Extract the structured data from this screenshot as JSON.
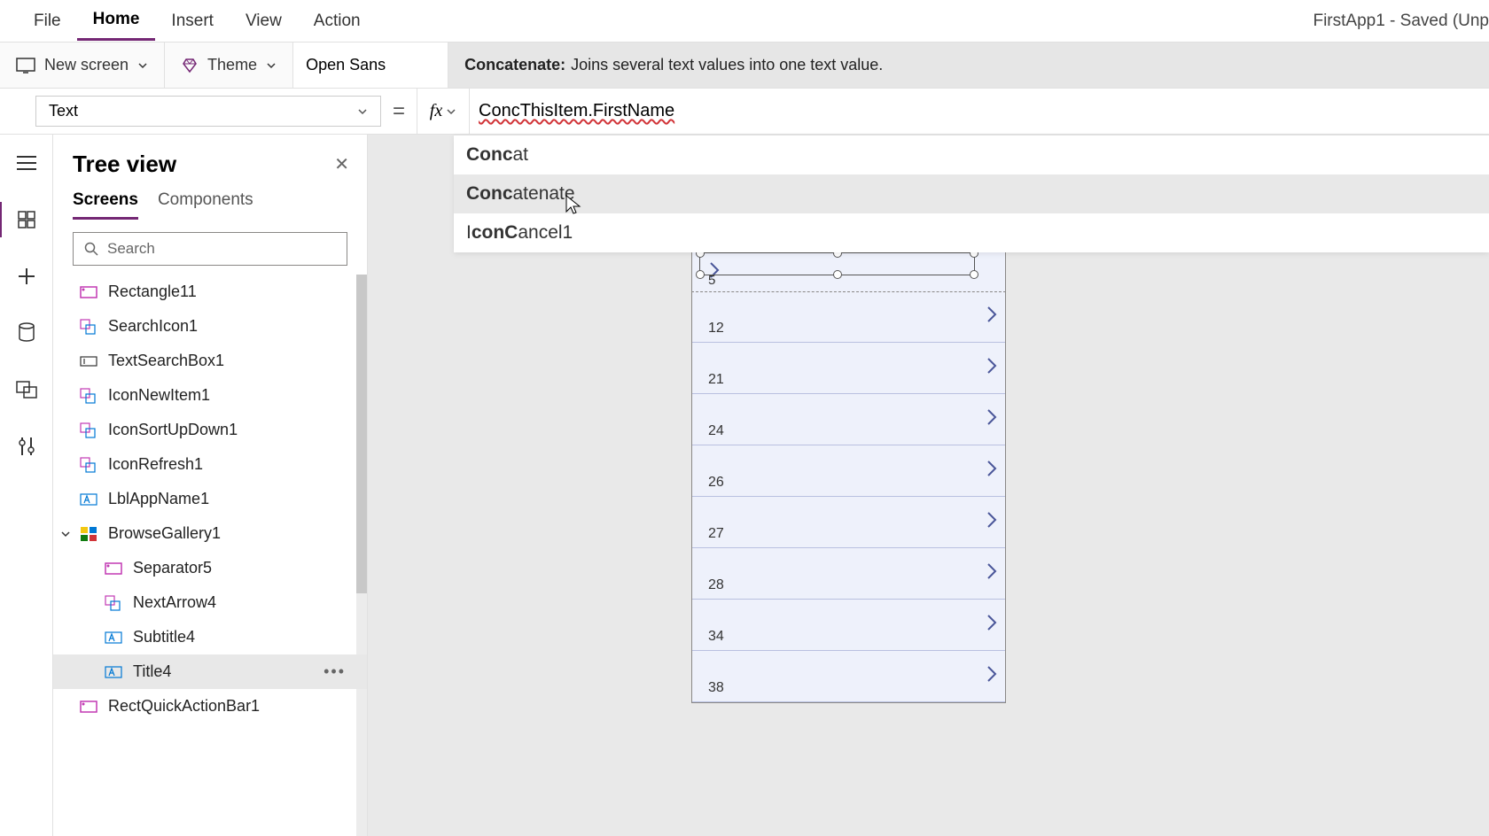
{
  "app_title": "FirstApp1 - Saved (Unp",
  "menubar": {
    "items": [
      "File",
      "Home",
      "Insert",
      "View",
      "Action"
    ],
    "active": "Home"
  },
  "toolbar": {
    "new_screen": "New screen",
    "theme": "Theme",
    "font": "Open Sans"
  },
  "tooltip": {
    "name": "Concatenate:",
    "desc": "Joins several text values into one text value."
  },
  "property_selector": "Text",
  "formula": "ConcThisItem.FirstName",
  "intellisense": {
    "items": [
      {
        "bold": "Conc",
        "rest": "at"
      },
      {
        "bold": "Conc",
        "rest": "atenate"
      },
      {
        "prefix": "I",
        "bold": "conC",
        "rest": "ancel1"
      }
    ],
    "selected_index": 1
  },
  "panel": {
    "title": "Tree view",
    "tabs": [
      "Screens",
      "Components"
    ],
    "active_tab": "Screens",
    "search_placeholder": "Search"
  },
  "tree": [
    {
      "label": "Rectangle11",
      "icon": "rect"
    },
    {
      "label": "SearchIcon1",
      "icon": "group"
    },
    {
      "label": "TextSearchBox1",
      "icon": "textbox"
    },
    {
      "label": "IconNewItem1",
      "icon": "group"
    },
    {
      "label": "IconSortUpDown1",
      "icon": "group"
    },
    {
      "label": "IconRefresh1",
      "icon": "group"
    },
    {
      "label": "LblAppName1",
      "icon": "label"
    },
    {
      "label": "BrowseGallery1",
      "icon": "gallery",
      "expanded": true
    },
    {
      "label": "Separator5",
      "icon": "rect",
      "child": true
    },
    {
      "label": "NextArrow4",
      "icon": "group",
      "child": true
    },
    {
      "label": "Subtitle4",
      "icon": "label",
      "child": true
    },
    {
      "label": "Title4",
      "icon": "label",
      "child": true,
      "selected": true
    },
    {
      "label": "RectQuickActionBar1",
      "icon": "rect"
    }
  ],
  "gallery_rows": [
    "5",
    "12",
    "21",
    "24",
    "26",
    "27",
    "28",
    "34",
    "38"
  ]
}
